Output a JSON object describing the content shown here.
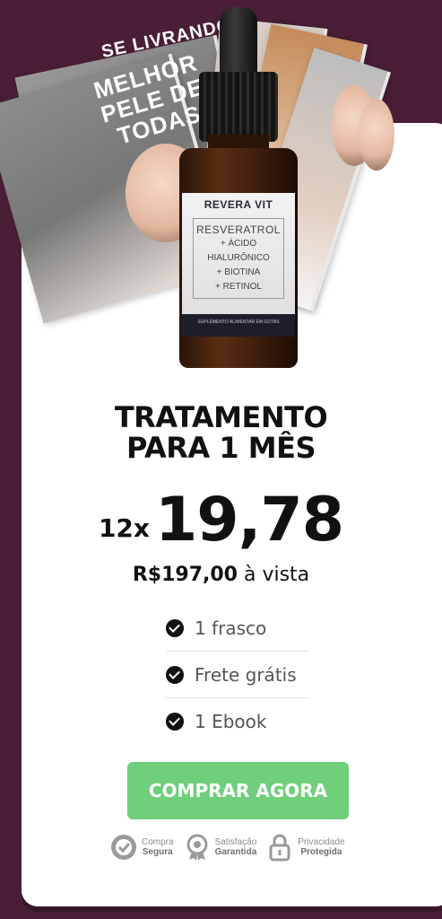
{
  "product": {
    "ebook_title_1": "SE LIVRANDO",
    "ebook_title_2": "MELHOR PELE DE TODAS",
    "brand": "REVERA VIT",
    "label_line1": "RESVERATROL",
    "label_line2": "+ ÁCIDO",
    "label_line3": "HIALURÔNICO",
    "label_line4": "+ BIOTINA",
    "label_line5": "+ RETINOL",
    "label_footer": "SUPLEMENTO ALIMENTAR EM GOTAS"
  },
  "offer": {
    "title_line1": "TRATAMENTO",
    "title_line2": "PARA 1 MÊS",
    "installments": "12x",
    "installment_value": "19,78",
    "cash_price": "R$197,00",
    "cash_suffix": " à vista"
  },
  "features": [
    "1 frasco",
    "Frete grátis",
    "1 Ebook"
  ],
  "cta": {
    "label": "COMPRAR AGORA",
    "color": "#6fcf7b"
  },
  "badges": [
    {
      "icon": "shield-check-icon",
      "line1": "Compra",
      "line2": "Segura"
    },
    {
      "icon": "award-ribbon-icon",
      "line1": "Satisfação",
      "line2": "Garantida"
    },
    {
      "icon": "lock-icon",
      "line1": "Privacidade",
      "line2": "Protegida"
    }
  ],
  "colors": {
    "background": "#4a1f35",
    "card": "#ffffff",
    "text": "#111111"
  }
}
